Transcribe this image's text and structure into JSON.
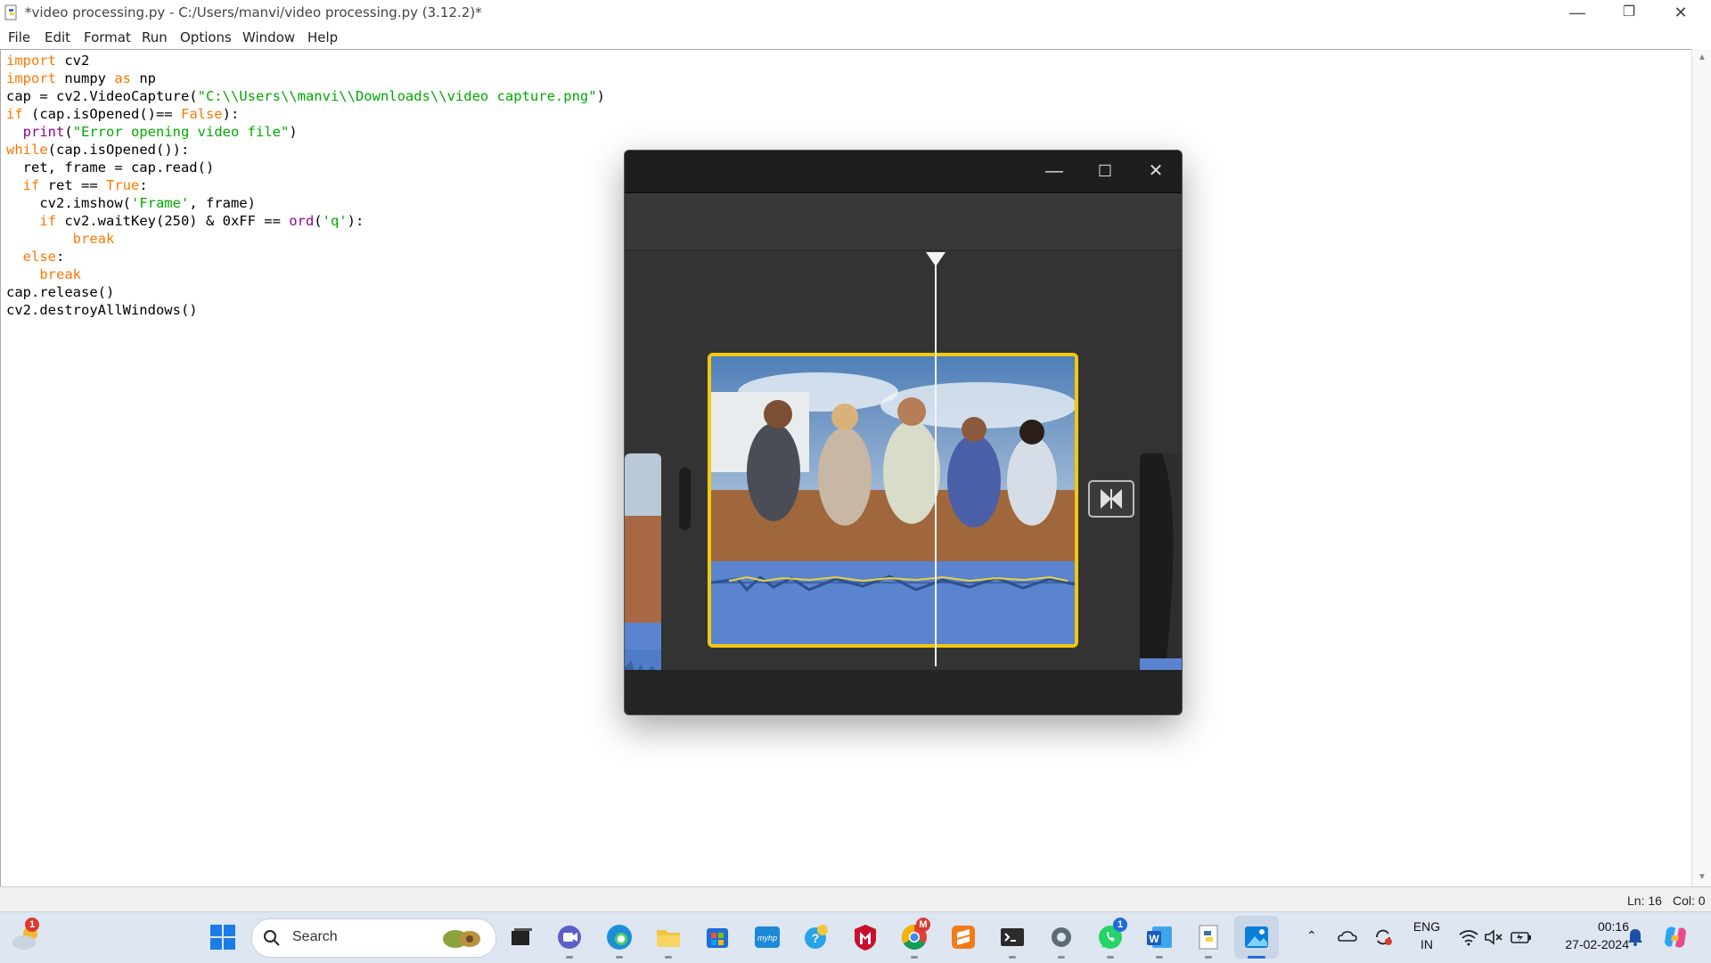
{
  "window": {
    "title": "*video processing.py - C:/Users/manvi/video processing.py (3.12.2)*",
    "controls": {
      "minimize": "—",
      "restore": "❐",
      "close": "✕"
    }
  },
  "menu": [
    "File",
    "Edit",
    "Format",
    "Run",
    "Options",
    "Window",
    "Help"
  ],
  "code_lines": [
    "import cv2",
    "import numpy as np",
    "cap = cv2.VideoCapture(\"C:\\\\Users\\\\manvi\\\\Downloads\\\\video capture.png\")",
    "if (cap.isOpened()== False):",
    "  print(\"Error opening video file\")",
    "while(cap.isOpened()):",
    "  ret, frame = cap.read()",
    "  if ret == True:",
    "    cv2.imshow('Frame', frame)",
    "    if cv2.waitKey(250) & 0xFF == ord('q'):",
    "        break",
    "  else:",
    "    break",
    "cap.release()",
    "cv2.destroyAllWindows()"
  ],
  "status": {
    "line": "Ln: 16",
    "col": "Col: 0"
  },
  "popup": {
    "controls": {
      "minimize": "—",
      "maximize": "☐",
      "close": "✕"
    },
    "transition_icon": "bowtie-transition-icon"
  },
  "taskbar": {
    "search_placeholder": "Search",
    "weather_badge": "1",
    "whatsapp_badge": "1",
    "chrome_badge": "M",
    "language": "ENG",
    "region": "IN",
    "time": "00:16",
    "date": "27-02-2024"
  },
  "colors": {
    "keyword": "#ff7700",
    "builtin": "#900090",
    "string": "#00aa00",
    "clip_border": "#f2c811",
    "audio_track": "#5a84cf"
  }
}
